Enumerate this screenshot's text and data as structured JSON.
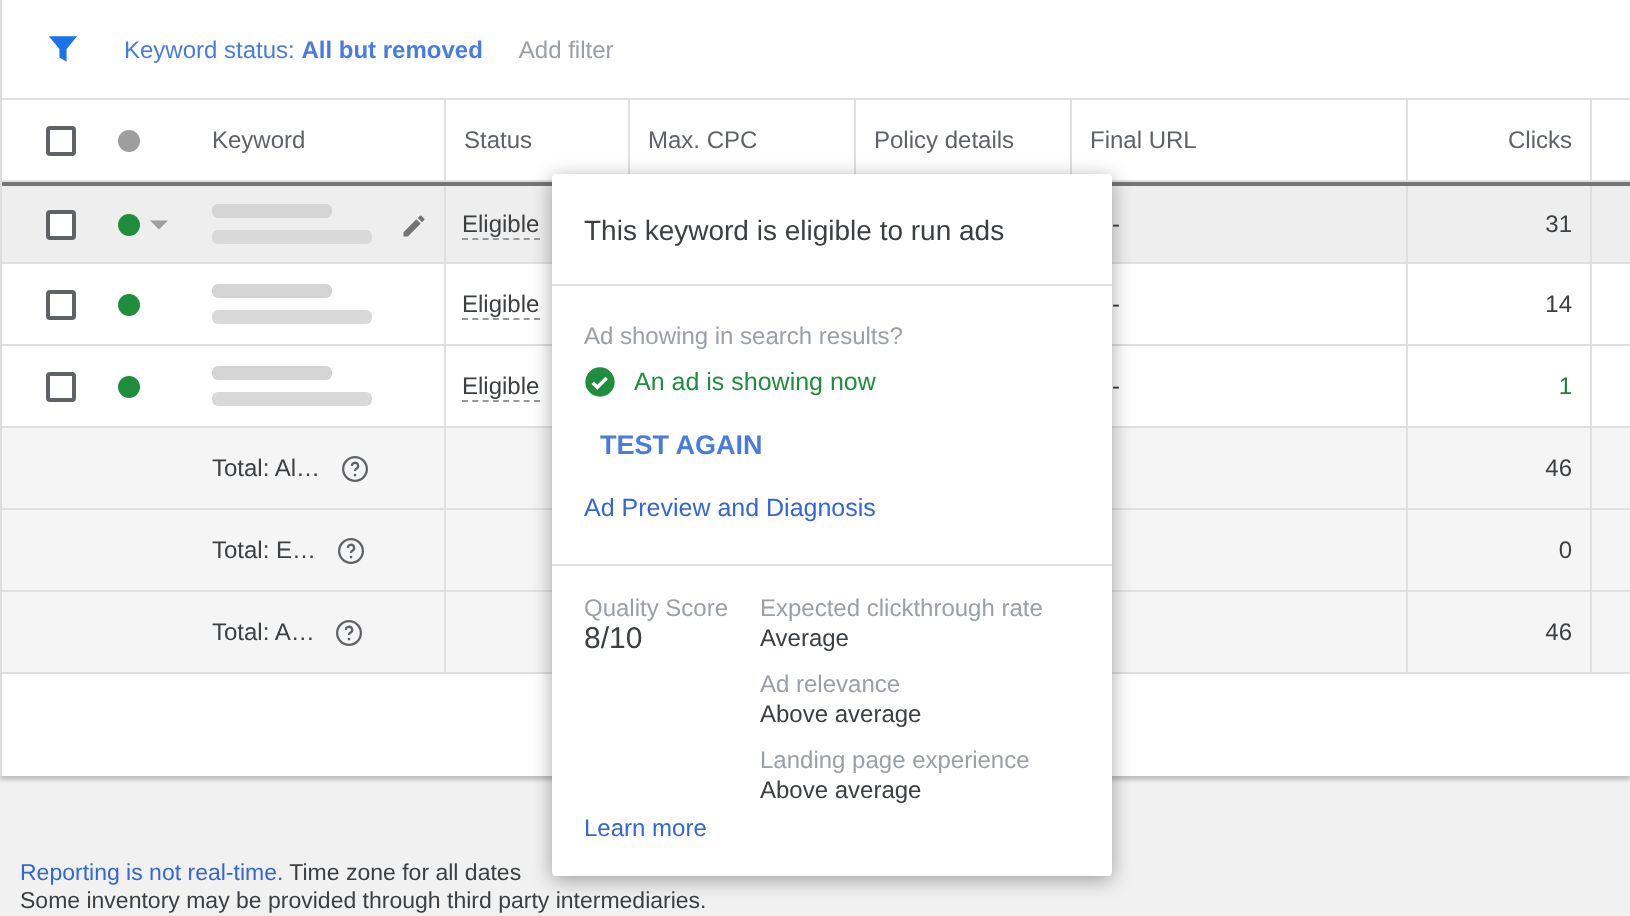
{
  "filter_bar": {
    "filter": "Keyword status: **All but removed**",
    "add_filter": "Add filter"
  },
  "table": {
    "select_all_checked": false,
    "columns": [
      "Keyword",
      "Status",
      "Max. CPC",
      "Policy details",
      "Final URL",
      "Clicks"
    ],
    "rows": [
      {
        "selected": true,
        "checked": false,
        "color": "#1e8e3e",
        "status": "Eligible",
        "final_url": "-",
        "clicks": "31"
      },
      {
        "selected": false,
        "checked": false,
        "color": "#1e8e3e",
        "status": "Eligible",
        "final_url": "-",
        "clicks": "14"
      },
      {
        "selected": false,
        "checked": false,
        "color": "#1e8e3e",
        "status": "Eligible",
        "final_url": "-",
        "clicks": "1"
      }
    ],
    "totals": [
      {
        "label": "Total: Al…",
        "clicks": "46"
      },
      {
        "label": "Total: E…",
        "clicks": "0"
      },
      {
        "label": "Total: A…",
        "clicks": "46"
      }
    ]
  },
  "popover": {
    "title": "This keyword is eligible to run ads",
    "question": "Ad showing in search results?",
    "result": "An ad is showing now",
    "test_button": "TEST AGAIN",
    "diagnosis_link": "Ad Preview and Diagnosis",
    "quality_label": "Quality Score",
    "quality_value": "8/10",
    "factors": [
      {
        "label": "Expected clickthrough rate",
        "value": "Average"
      },
      {
        "label": "Ad relevance",
        "value": "Above average"
      },
      {
        "label": "Landing page experience",
        "value": "Above average"
      }
    ],
    "learn_more": "Learn more"
  },
  "footer": {
    "link": "Reporting is not real-time.",
    "text": "Time zone for all dates",
    "note": "Some inventory may be provided through third party intermediaries."
  }
}
